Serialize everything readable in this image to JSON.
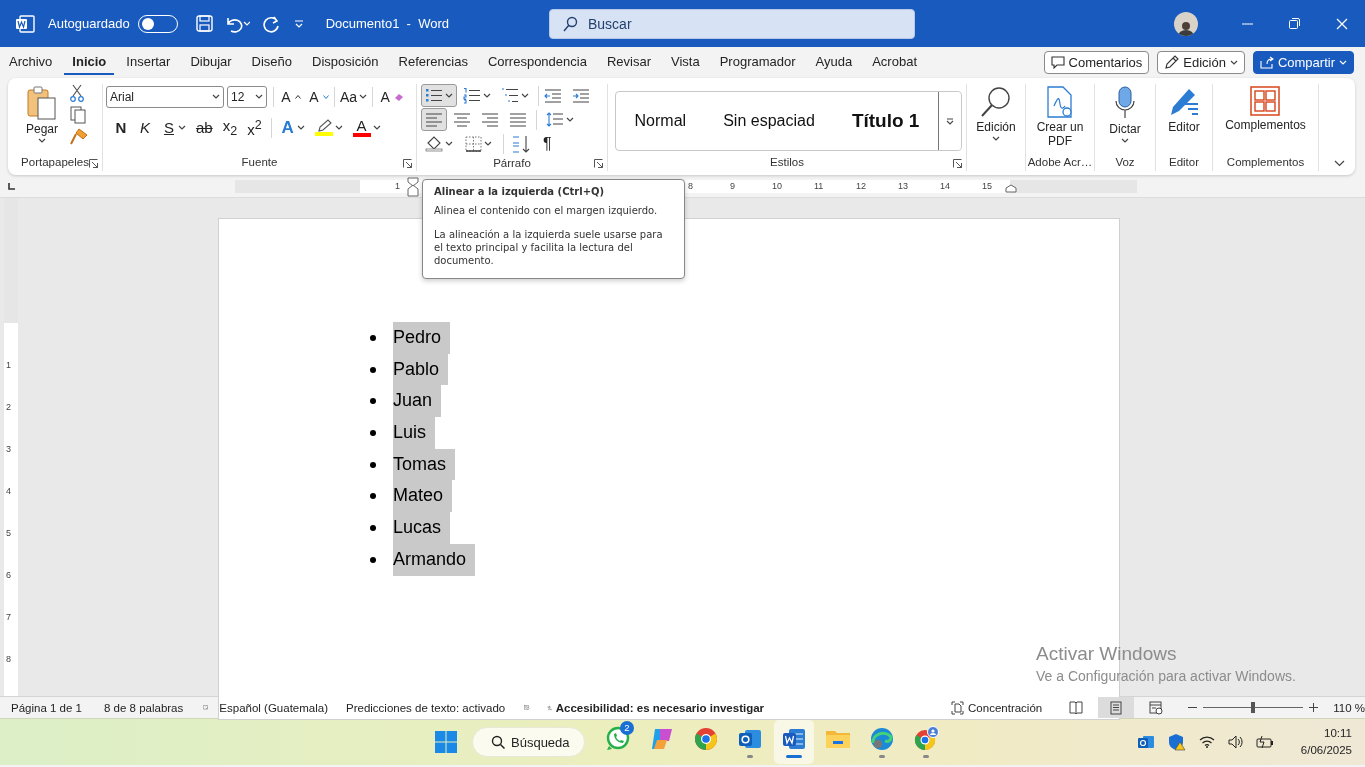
{
  "title_bar": {
    "autosave_label": "Autoguardado",
    "autosave_on": false,
    "document_title": "Documento1  -  Word",
    "search_placeholder": "Buscar"
  },
  "menu_tabs": [
    {
      "label": "Archivo",
      "selected": false
    },
    {
      "label": "Inicio",
      "selected": true
    },
    {
      "label": "Insertar",
      "selected": false
    },
    {
      "label": "Dibujar",
      "selected": false
    },
    {
      "label": "Diseño",
      "selected": false
    },
    {
      "label": "Disposición",
      "selected": false
    },
    {
      "label": "Referencias",
      "selected": false
    },
    {
      "label": "Correspondencia",
      "selected": false
    },
    {
      "label": "Revisar",
      "selected": false
    },
    {
      "label": "Vista",
      "selected": false
    },
    {
      "label": "Programador",
      "selected": false
    },
    {
      "label": "Ayuda",
      "selected": false
    },
    {
      "label": "Acrobat",
      "selected": false
    }
  ],
  "header_buttons": [
    {
      "kind": "comments",
      "label": "Comentarios"
    },
    {
      "kind": "editing",
      "label": "Edición"
    },
    {
      "kind": "share",
      "label": "Compartir"
    }
  ],
  "ribbon": {
    "clipboard": {
      "paste_label": "Pegar",
      "group_label": "Portapapeles"
    },
    "font": {
      "font_name": "Arial",
      "font_size": "12",
      "group_label": "Fuente",
      "row1": [
        {
          "kind": "grow",
          "label": "A"
        },
        {
          "kind": "shrink",
          "label": "A"
        },
        {
          "kind": "case",
          "label": "Aa"
        },
        {
          "kind": "clear",
          "label": "A"
        }
      ],
      "row2": [
        {
          "kind": "bold",
          "label": "N"
        },
        {
          "kind": "italic",
          "label": "K"
        },
        {
          "kind": "underline",
          "label": "S"
        },
        {
          "kind": "strike",
          "label": "ab"
        },
        {
          "kind": "sub",
          "label": "x$_{2}$"
        },
        {
          "kind": "sup",
          "label": "x$^{2}$"
        },
        {
          "kind": "effects",
          "label": "A"
        },
        {
          "kind": "highlight",
          "color": "#ffff00"
        },
        {
          "kind": "color",
          "label": "A",
          "color": "#ff0000"
        }
      ]
    },
    "paragraph": {
      "group_label": "Párrafo",
      "pilcrow": "¶",
      "lists": [
        {
          "kind": "bullets",
          "selected": true
        },
        {
          "kind": "numbering",
          "selected": false
        },
        {
          "kind": "multilevel",
          "selected": false
        }
      ],
      "align": [
        {
          "kind": "left",
          "selected": true
        },
        {
          "kind": "center",
          "selected": false
        },
        {
          "kind": "right",
          "selected": false
        },
        {
          "kind": "justify",
          "selected": false
        }
      ]
    },
    "styles": {
      "group_label": "Estilos",
      "items": [
        {
          "kind": "normal",
          "label": "Normal"
        },
        {
          "kind": "plain",
          "label": "Sin espaciad"
        },
        {
          "kind": "heading",
          "label": "Título 1"
        }
      ]
    },
    "commands": [
      {
        "kind": "find",
        "label": "Edición",
        "dropdown": true
      },
      {
        "kind": "pdf",
        "label": "Crear un PDF",
        "group_label": "Adobe Acr…"
      },
      {
        "kind": "dictate",
        "label": "Dictar",
        "dropdown": true,
        "group_label": "Voz"
      },
      {
        "kind": "editor",
        "label": "Editor",
        "group_label": "Editor"
      },
      {
        "kind": "addins",
        "label": "Complementos",
        "group_label": "Complementos"
      }
    ]
  },
  "rulers": {
    "horizontal_numbers": [
      "1",
      "8",
      "9",
      "10",
      "11",
      "12",
      "13",
      "14",
      "15"
    ],
    "vertical_numbers": [
      "1",
      "2",
      "3",
      "4",
      "5",
      "6",
      "7",
      "8"
    ]
  },
  "tooltip": {
    "title": "Alinear a la izquierda (Ctrl+Q)",
    "paragraphs": [
      "Alinea el contenido con el margen izquierdo.",
      "La alineación a la izquierda suele usarse para el texto principal y facilita la lectura del documento."
    ]
  },
  "document": {
    "items": [
      {
        "text": "Pedro",
        "selected": true
      },
      {
        "text": "Pablo",
        "selected": true
      },
      {
        "text": "Juan",
        "selected": true
      },
      {
        "text": "Luis",
        "selected": true
      },
      {
        "text": "Tomas",
        "selected": true
      },
      {
        "text": "Mateo",
        "selected": true
      },
      {
        "text": "Lucas",
        "selected": true
      },
      {
        "text": "Armando",
        "selected": true
      }
    ]
  },
  "activation_notice": {
    "title": "Activar Windows",
    "subtitle": "Ve a Configuración para activar Windows."
  },
  "status_bar": {
    "page": "Página 1 de 1",
    "words": "8 de 8 palabras",
    "language": "Español (Guatemala)",
    "predictions": "Predicciones de texto: activado",
    "accessibility": "Accesibilidad: es necesario investigar",
    "focus": "Concentración",
    "views": [
      {
        "kind": "read",
        "selected": false
      },
      {
        "kind": "print",
        "selected": true
      },
      {
        "kind": "web",
        "selected": false
      }
    ],
    "zoom": {
      "level": 0.5,
      "label": "110 %"
    }
  },
  "taskbar": {
    "search_label": "Búsqueda",
    "apps": [
      {
        "kind": "whatsapp",
        "badge": "2",
        "running": false,
        "active": false
      },
      {
        "kind": "copilot",
        "running": false,
        "active": false
      },
      {
        "kind": "chrome",
        "running": false,
        "active": false
      },
      {
        "kind": "outlook",
        "running": true,
        "active": false
      },
      {
        "kind": "word",
        "running": true,
        "active": true
      },
      {
        "kind": "explorer",
        "running": false,
        "active": false
      },
      {
        "kind": "edge",
        "running": true,
        "active": false
      },
      {
        "kind": "chrome-profile",
        "running": true,
        "active": false
      }
    ],
    "time": "10:11",
    "date": "6/06/2025"
  }
}
